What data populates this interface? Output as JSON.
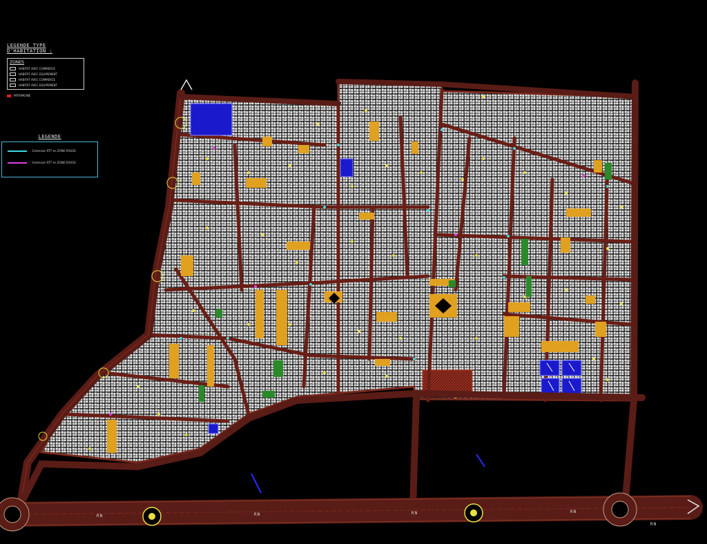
{
  "legend_top": {
    "title": "LEGENDE TYPE D'HABITATION :",
    "zones_heading": "ZONES",
    "zones": [
      {
        "label": "HABITAT AVEC COMMERCE",
        "color": "#111111"
      },
      {
        "label": "HABITAT AVEC EQUIPEMENT",
        "color": "#111111"
      },
      {
        "label": "HABITAT AVEC COMMERCE",
        "color": "#111111"
      },
      {
        "label": "HABITAT AVEC EQUIPEMENT",
        "color": "#111111"
      }
    ],
    "patrimoine": {
      "label": "PATRIMOINE",
      "color": "#e02020"
    }
  },
  "legend_bottom": {
    "title": "LEGENDE",
    "items": [
      {
        "label": "Extension RTT en ZONE ROUGE",
        "color": "#40d8e0"
      },
      {
        "label": "Extension RTT en ZONE ROUGE",
        "color": "#e040e0"
      }
    ]
  },
  "road_labels": [
    "RN",
    "RN",
    "RN",
    "RN",
    "RN"
  ],
  "colors": {
    "background": "#000000",
    "road": "#5a1c16",
    "road_edge": "#8a2a1e",
    "block": "#e8e8e8",
    "equipment": "#e0a020",
    "water": "#1a1acc",
    "green": "#2a8a2a",
    "marker": "#e8e040"
  }
}
